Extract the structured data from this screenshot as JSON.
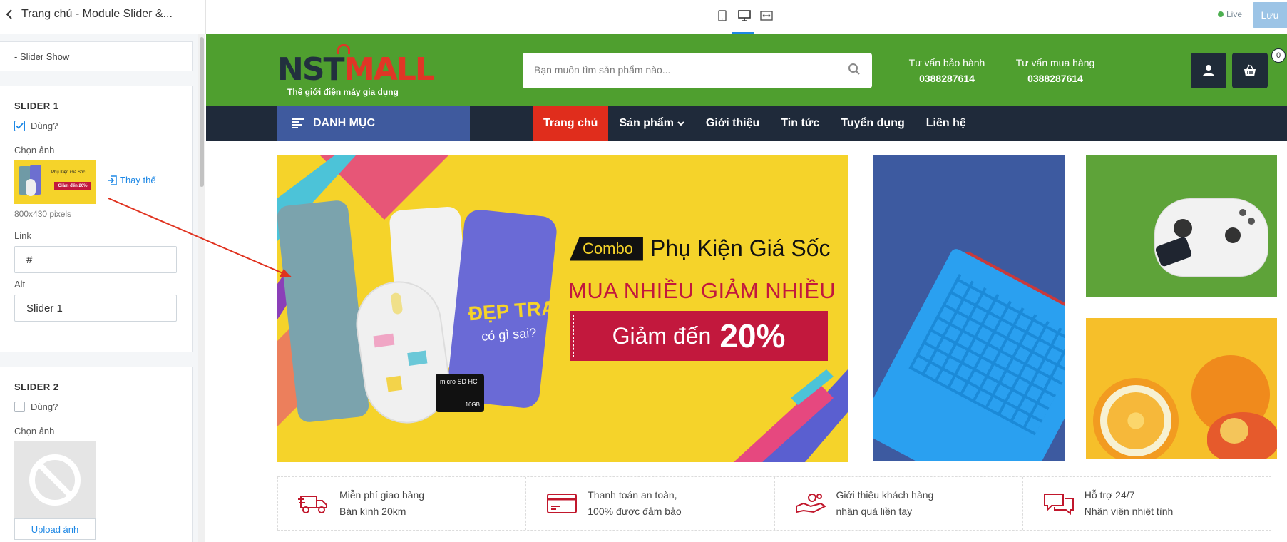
{
  "editor": {
    "title": "Trang chủ - Module Slider &...",
    "live_label": "Live",
    "save_label": "Lưu"
  },
  "panel": {
    "section_label": "- Slider Show",
    "slider1": {
      "heading": "SLIDER 1",
      "use_label": "Dùng?",
      "use_checked": true,
      "image_label": "Chọn ảnh",
      "thumb_text": [
        "Phụ Kiện Giá Sốc",
        "Giảm đến 20%"
      ],
      "replace_label": "Thay thế",
      "size_text": "800x430 pixels",
      "link_label": "Link",
      "link_value": "#",
      "alt_label": "Alt",
      "alt_value": "Slider 1"
    },
    "slider2": {
      "heading": "SLIDER 2",
      "use_label": "Dùng?",
      "use_checked": false,
      "image_label": "Chọn ảnh",
      "upload_label": "Upload ảnh"
    }
  },
  "site": {
    "logo": {
      "part1": "NST",
      "part2": "MALL",
      "tagline": "Thế giới điện máy gia dụng"
    },
    "search_placeholder": "Bạn muốn tìm sản phẩm nào...",
    "hotlines": [
      {
        "title": "Tư vấn bảo hành",
        "number": "0388287614"
      },
      {
        "title": "Tư vấn mua hàng",
        "number": "0388287614"
      }
    ],
    "cart_count": "0",
    "category_label": "DANH MỤC",
    "menu": [
      {
        "label": "Trang chủ",
        "active": true
      },
      {
        "label": "Sản phẩm",
        "active": false
      },
      {
        "label": "Giới thiệu",
        "active": false
      },
      {
        "label": "Tin tức",
        "active": false
      },
      {
        "label": "Tuyển dụng",
        "active": false
      },
      {
        "label": "Liên hệ",
        "active": false
      }
    ],
    "banner": {
      "combo": "Combo",
      "headline": "Phụ Kiện Giá Sốc",
      "subline": "MUA NHIỀU GIẢM NHIỀU",
      "discount_prefix": "Giảm đến",
      "discount_value": "20%",
      "case_text_1": "ĐẸP TRAI",
      "case_text_2": "có gì sai?",
      "sd_text": "micro SD HC",
      "sd_size": "16GB"
    },
    "features": [
      {
        "line1": "Miễn phí giao hàng",
        "line2": "Bán kính 20km",
        "icon": "truck-icon"
      },
      {
        "line1": "Thanh toán an toàn,",
        "line2": "100% được đảm bảo",
        "icon": "credit-card-icon"
      },
      {
        "line1": "Giới thiệu khách hàng",
        "line2": "nhận quà liền tay",
        "icon": "hand-coins-icon"
      },
      {
        "line1": "Hỗ trợ 24/7",
        "line2": "Nhân viên nhiệt tình",
        "icon": "chat-icon"
      }
    ]
  },
  "colors": {
    "header_green": "#4f9f2f",
    "nav_dark": "#1f2a3a",
    "category_blue": "#3f5a9e",
    "active_red": "#e02d1c",
    "banner_yellow": "#f5d32a",
    "accent_blue": "#1e88e5"
  }
}
